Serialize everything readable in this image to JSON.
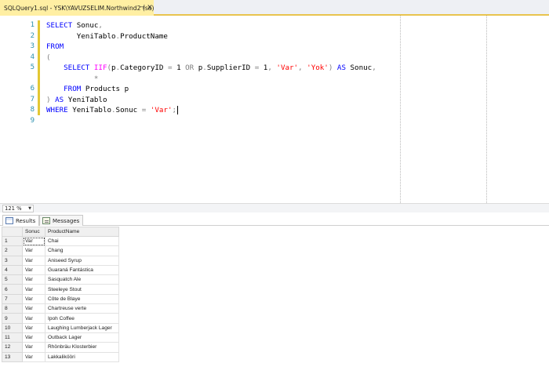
{
  "document_tab": {
    "title": "SQLQuery1.sql - YSK\\YAVUZSELIM.Northwind2 (sa)",
    "pin_glyph": "⊣",
    "close_glyph": "✕"
  },
  "editor": {
    "line_numbers": [
      "1",
      "2",
      "3",
      "4",
      "5",
      "",
      "6",
      "7",
      "8",
      "9"
    ],
    "lines": [
      [
        {
          "t": "SELECT ",
          "c": "kw"
        },
        {
          "t": "Sonuc",
          "c": ""
        },
        {
          "t": ",",
          "c": "op"
        }
      ],
      [
        {
          "t": "       YeniTablo",
          "c": ""
        },
        {
          "t": ".",
          "c": "op"
        },
        {
          "t": "ProductName",
          "c": ""
        }
      ],
      [
        {
          "t": "FROM",
          "c": "kw"
        }
      ],
      [
        {
          "t": "(",
          "c": "op"
        }
      ],
      [
        {
          "t": "    ",
          "c": ""
        },
        {
          "t": "SELECT ",
          "c": "kw"
        },
        {
          "t": "IIF",
          "c": "fn"
        },
        {
          "t": "(",
          "c": "op"
        },
        {
          "t": "p",
          "c": ""
        },
        {
          "t": ".",
          "c": "op"
        },
        {
          "t": "CategoryID ",
          "c": ""
        },
        {
          "t": "= ",
          "c": "op"
        },
        {
          "t": "1 ",
          "c": ""
        },
        {
          "t": "OR ",
          "c": "op"
        },
        {
          "t": "p",
          "c": ""
        },
        {
          "t": ".",
          "c": "op"
        },
        {
          "t": "SupplierID ",
          "c": ""
        },
        {
          "t": "= ",
          "c": "op"
        },
        {
          "t": "1",
          "c": ""
        },
        {
          "t": ", ",
          "c": "op"
        },
        {
          "t": "'Var'",
          "c": "str"
        },
        {
          "t": ", ",
          "c": "op"
        },
        {
          "t": "'Yok'",
          "c": "str"
        },
        {
          "t": ") ",
          "c": "op"
        },
        {
          "t": "AS ",
          "c": "kw"
        },
        {
          "t": "Sonuc",
          "c": ""
        },
        {
          "t": ",",
          "c": "op"
        }
      ],
      [
        {
          "t": "           ",
          "c": ""
        },
        {
          "t": "*",
          "c": "op"
        }
      ],
      [
        {
          "t": "    ",
          "c": ""
        },
        {
          "t": "FROM ",
          "c": "kw"
        },
        {
          "t": "Products p",
          "c": ""
        }
      ],
      [
        {
          "t": ") ",
          "c": "op"
        },
        {
          "t": "AS ",
          "c": "kw"
        },
        {
          "t": "YeniTablo",
          "c": ""
        }
      ],
      [
        {
          "t": "WHERE ",
          "c": "kw"
        },
        {
          "t": "YeniTablo",
          "c": ""
        },
        {
          "t": ".",
          "c": "op"
        },
        {
          "t": "Sonuc ",
          "c": ""
        },
        {
          "t": "= ",
          "c": "op"
        },
        {
          "t": "'Var'",
          "c": "str"
        },
        {
          "t": ";",
          "c": "op"
        }
      ]
    ]
  },
  "zoom": {
    "value": "121 %",
    "arrow_glyph": "▼"
  },
  "results_tabs": [
    {
      "label": "Results",
      "icon": "grid-icon",
      "active": true
    },
    {
      "label": "Messages",
      "icon": "messages-icon",
      "active": false
    }
  ],
  "grid": {
    "columns": [
      "Sonuc",
      "ProductName"
    ],
    "rows": [
      [
        "1",
        "Var",
        "Chai"
      ],
      [
        "2",
        "Var",
        "Chang"
      ],
      [
        "3",
        "Var",
        "Aniseed Syrup"
      ],
      [
        "4",
        "Var",
        "Guaraná Fantástica"
      ],
      [
        "5",
        "Var",
        "Sasquatch Ale"
      ],
      [
        "6",
        "Var",
        "Steeleye Stout"
      ],
      [
        "7",
        "Var",
        "Côte de Blaye"
      ],
      [
        "8",
        "Var",
        "Chartreuse verte"
      ],
      [
        "9",
        "Var",
        "Ipoh Coffee"
      ],
      [
        "10",
        "Var",
        "Laughing Lumberjack Lager"
      ],
      [
        "11",
        "Var",
        "Outback Lager"
      ],
      [
        "12",
        "Var",
        "Rhönbräu Klosterbier"
      ],
      [
        "13",
        "Var",
        "Lakkalikööri"
      ]
    ]
  },
  "colors": {
    "active_tab": "#ffefa3",
    "keyword": "#0000ff",
    "function": "#ff00ff",
    "string": "#ff0000",
    "operator": "#808080",
    "line_number": "#2b91af",
    "change_marker": "#e3c733"
  }
}
